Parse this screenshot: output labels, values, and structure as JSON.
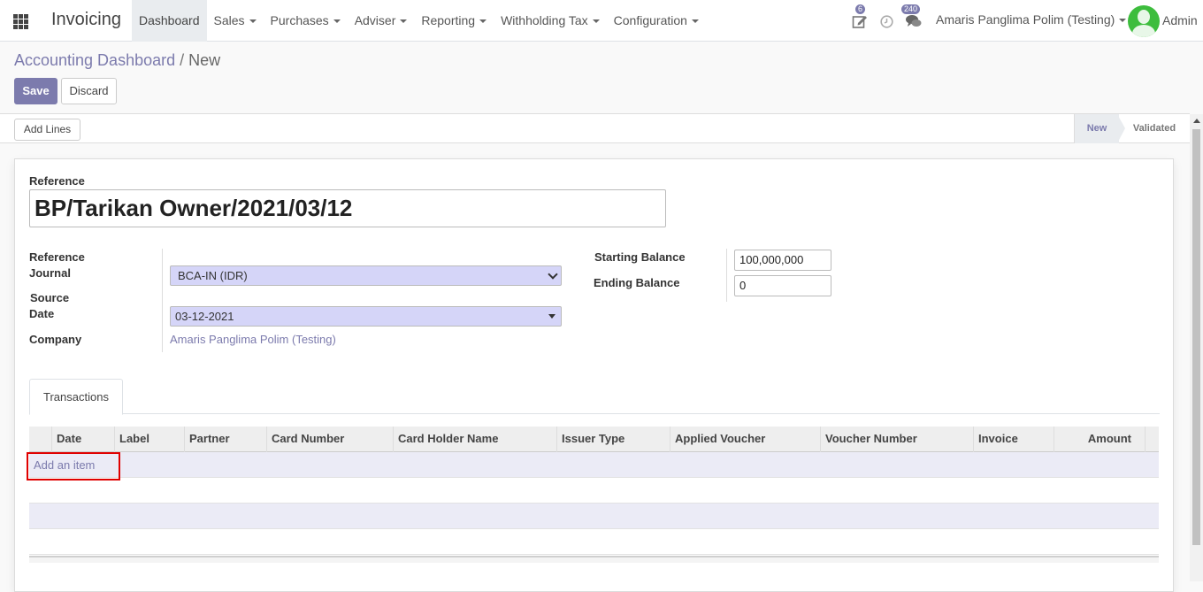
{
  "app": {
    "brand": "Invoicing"
  },
  "menu": [
    {
      "label": "Dashboard",
      "dropdown": false,
      "active": true
    },
    {
      "label": "Sales",
      "dropdown": true
    },
    {
      "label": "Purchases",
      "dropdown": true
    },
    {
      "label": "Adviser",
      "dropdown": true
    },
    {
      "label": "Reporting",
      "dropdown": true
    },
    {
      "label": "Withholding Tax",
      "dropdown": true
    },
    {
      "label": "Configuration",
      "dropdown": true
    }
  ],
  "systray": {
    "activity_count": "6",
    "message_count": "240",
    "company": "Amaris Panglima Polim (Testing)",
    "user": "Admin"
  },
  "breadcrumb": {
    "parent": "Accounting Dashboard",
    "separator": "/",
    "current": "New"
  },
  "buttons": {
    "save": "Save",
    "discard": "Discard",
    "add_lines": "Add Lines"
  },
  "status": {
    "stages": [
      "New",
      "Validated"
    ],
    "current": "New"
  },
  "form": {
    "reference_label": "Reference",
    "reference_value": "BP/Tarikan Owner/2021/03/12",
    "ref_journal_label": "Reference\nJournal",
    "ref_journal_label_1": "Reference",
    "ref_journal_label_2": "Journal",
    "journal_value": "BCA-IN (IDR)",
    "source_date_label_1": "Source",
    "source_date_label_2": "Date",
    "date_value": "03-12-2021",
    "company_label": "Company",
    "company_value": "Amaris Panglima Polim (Testing)",
    "starting_balance_label": "Starting Balance",
    "starting_balance_value": "100,000,000",
    "ending_balance_label": "Ending Balance",
    "ending_balance_value": "0"
  },
  "tabs": {
    "transactions": "Transactions"
  },
  "table": {
    "columns": [
      "Date",
      "Label",
      "Partner",
      "Card Number",
      "Card Holder Name",
      "Issuer Type",
      "Applied Voucher",
      "Voucher Number",
      "Invoice",
      "Amount"
    ],
    "add_item": "Add an item"
  },
  "colors": {
    "accent": "#7c7bad",
    "highlight": "#e00000",
    "select_bg": "#d5d5f8"
  }
}
